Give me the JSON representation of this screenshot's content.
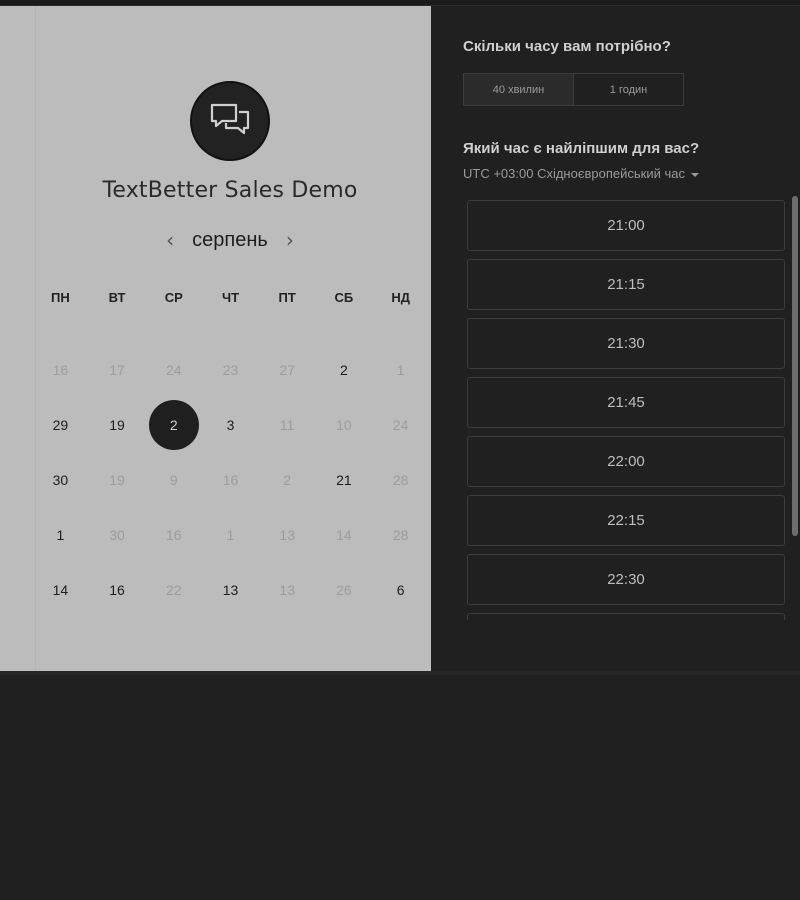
{
  "app": {
    "title": "TextBetter Sales Demo",
    "logo_icon": "chat-bubbles-icon"
  },
  "calendar": {
    "month": "серпень",
    "prev_icon": "chevron-left-icon",
    "next_icon": "chevron-right-icon",
    "weekdays": [
      "ПН",
      "ВТ",
      "СР",
      "ЧТ",
      "ПТ",
      "СБ",
      "НД"
    ],
    "weeks": [
      [
        {
          "d": "16",
          "s": "muted"
        },
        {
          "d": "17",
          "s": "muted"
        },
        {
          "d": "24",
          "s": "muted"
        },
        {
          "d": "23",
          "s": "muted"
        },
        {
          "d": "27",
          "s": "muted"
        },
        {
          "d": "2",
          "s": "active"
        },
        {
          "d": "1",
          "s": "muted"
        }
      ],
      [
        {
          "d": "29",
          "s": "active"
        },
        {
          "d": "19",
          "s": "active"
        },
        {
          "d": "2",
          "s": "selected"
        },
        {
          "d": "3",
          "s": "active"
        },
        {
          "d": "11",
          "s": "muted"
        },
        {
          "d": "10",
          "s": "muted"
        },
        {
          "d": "24",
          "s": "muted"
        }
      ],
      [
        {
          "d": "30",
          "s": "active"
        },
        {
          "d": "19",
          "s": "muted"
        },
        {
          "d": "9",
          "s": "muted"
        },
        {
          "d": "16",
          "s": "muted"
        },
        {
          "d": "2",
          "s": "muted"
        },
        {
          "d": "21",
          "s": "active"
        },
        {
          "d": "28",
          "s": "muted"
        }
      ],
      [
        {
          "d": "1",
          "s": "active"
        },
        {
          "d": "30",
          "s": "muted"
        },
        {
          "d": "16",
          "s": "muted"
        },
        {
          "d": "1",
          "s": "muted"
        },
        {
          "d": "13",
          "s": "muted"
        },
        {
          "d": "14",
          "s": "muted"
        },
        {
          "d": "28",
          "s": "muted"
        }
      ],
      [
        {
          "d": "14",
          "s": "active"
        },
        {
          "d": "16",
          "s": "active"
        },
        {
          "d": "22",
          "s": "muted"
        },
        {
          "d": "13",
          "s": "active"
        },
        {
          "d": "13",
          "s": "muted"
        },
        {
          "d": "26",
          "s": "muted"
        },
        {
          "d": "6",
          "s": "active"
        }
      ]
    ]
  },
  "booking": {
    "duration_question": "Скільки часу вам потрібно?",
    "durations": [
      "40 хвилин",
      "1 годин"
    ],
    "selected_duration": "40 хвилин",
    "time_question": "Який час є найліпшим для вас?",
    "timezone": "UTC +03:00 Східноєвропейський час",
    "slots": [
      "21:00",
      "21:15",
      "21:30",
      "21:45",
      "22:00",
      "22:15",
      "22:30",
      ""
    ]
  },
  "colors": {
    "left_bg": "#bcbcbc",
    "right_bg": "#202020",
    "selected_day_bg": "#1f1f1f"
  }
}
